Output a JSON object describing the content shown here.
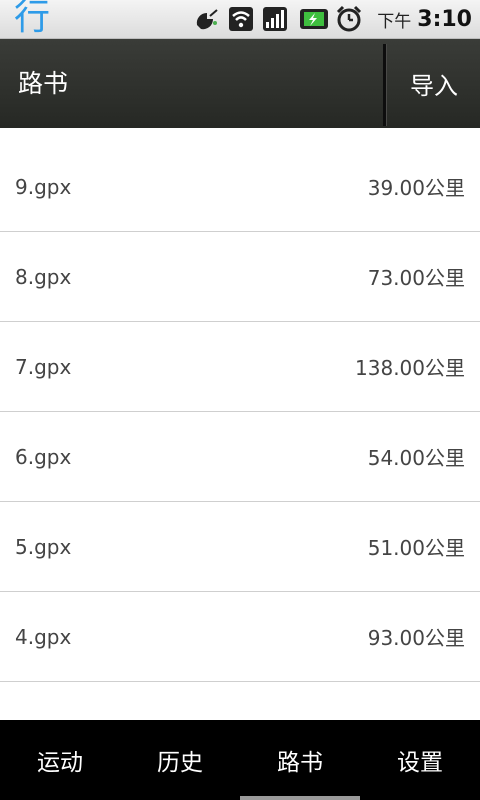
{
  "statusbar": {
    "app_glyph": "行",
    "icons": [
      "satellite-icon",
      "wifi-icon",
      "signal-icon",
      "battery-charging-icon",
      "alarm-clock-icon"
    ],
    "ampm": "下午",
    "time": "3:10"
  },
  "header": {
    "title": "路书",
    "import_label": "导入"
  },
  "routes": [
    {
      "name": "9.gpx",
      "distance": "39.00公里"
    },
    {
      "name": "8.gpx",
      "distance": "73.00公里"
    },
    {
      "name": "7.gpx",
      "distance": "138.00公里"
    },
    {
      "name": "6.gpx",
      "distance": "54.00公里"
    },
    {
      "name": "5.gpx",
      "distance": "51.00公里"
    },
    {
      "name": "4.gpx",
      "distance": "93.00公里"
    }
  ],
  "tabs": [
    {
      "label": "运动"
    },
    {
      "label": "历史"
    },
    {
      "label": "路书"
    },
    {
      "label": "设置"
    }
  ],
  "active_tab": "路书",
  "colors": {
    "app_icon": "#2e9be8",
    "header_bg": "#30322e",
    "tabbar_bg": "#000000"
  }
}
